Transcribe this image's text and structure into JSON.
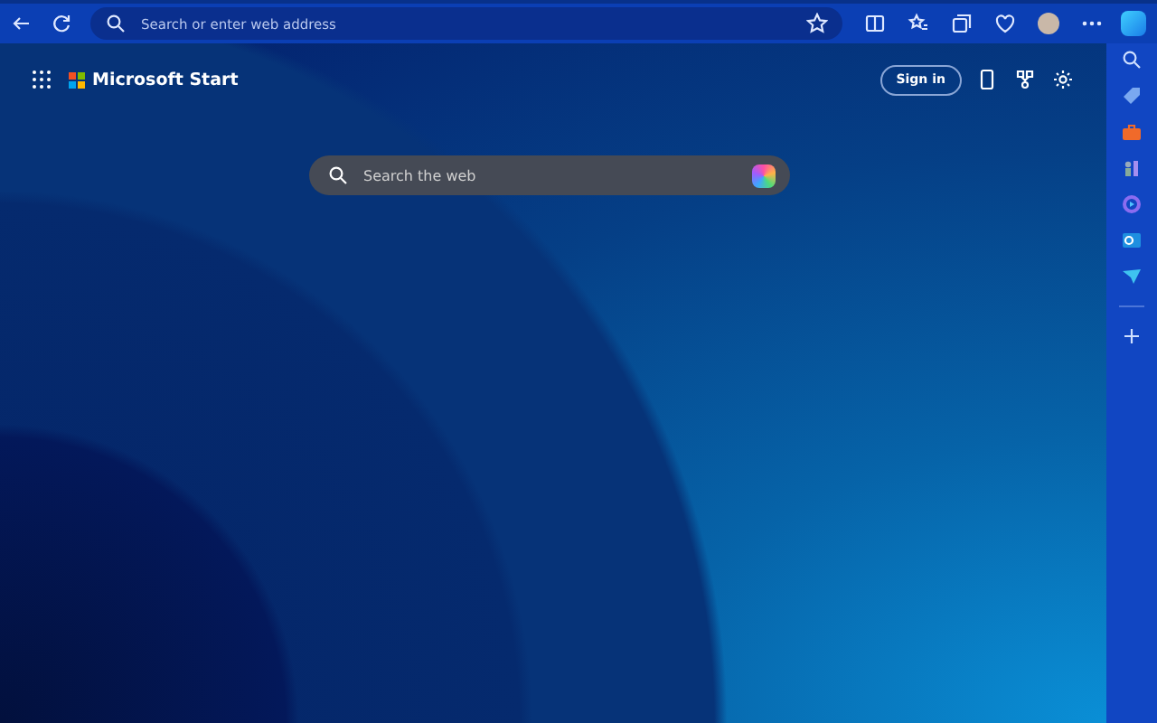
{
  "address_bar": {
    "placeholder": "Search or enter web address"
  },
  "header": {
    "brand": "Microsoft Start",
    "sign_in": "Sign in"
  },
  "search": {
    "placeholder": "Search the web"
  }
}
